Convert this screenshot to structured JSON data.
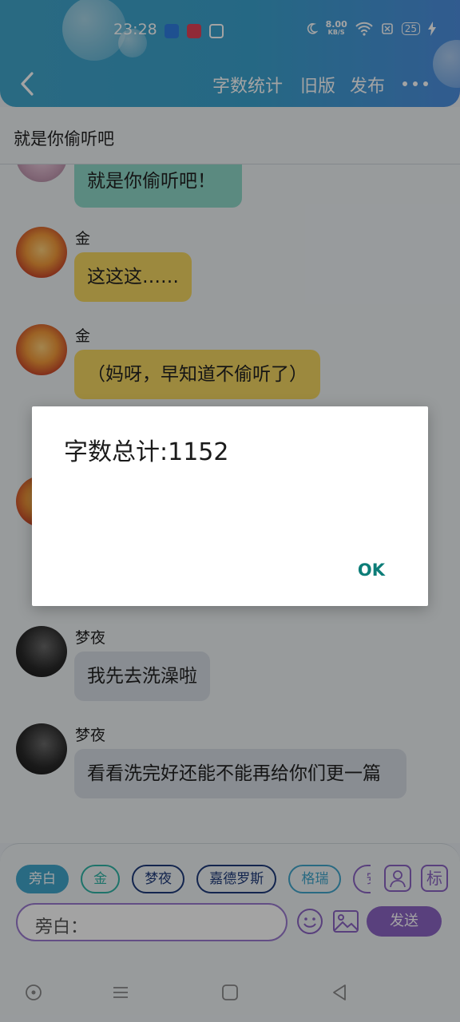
{
  "status_bar": {
    "time": "23:28",
    "net_speed_value": "8.00",
    "net_speed_unit": "KB/S",
    "battery": "25"
  },
  "nav": {
    "actions": [
      "字数统计",
      "旧版",
      "发布"
    ]
  },
  "subtitle": "就是你偷听吧",
  "messages": [
    {
      "sender": "",
      "text": "就是你偷听吧！",
      "bubble": "teal"
    },
    {
      "sender": "金",
      "text": "这这这……",
      "bubble": "yellow"
    },
    {
      "sender": "金",
      "text": "（妈呀，早知道不偷听了）",
      "bubble": "yellow"
    },
    {
      "sender": "梦夜",
      "text": "我先去洗澡啦",
      "bubble": "gray"
    },
    {
      "sender": "梦夜",
      "text": "看看洗完好还能不能再给你们更一篇",
      "bubble": "gray"
    }
  ],
  "dialog": {
    "message": "字数总计:1152",
    "ok_label": "OK"
  },
  "input_bar": {
    "roles": [
      "旁白",
      "金",
      "梦夜",
      "嘉德罗斯",
      "格瑞",
      "安"
    ],
    "selected_role": "旁白",
    "placeholder": "旁白：",
    "role_icon_label": "标",
    "send_label": "发送"
  },
  "colors": {
    "header": "#41a6cc",
    "accent_purple": "#8b64c4",
    "ok_teal": "#0c7d78",
    "bubble_teal": "#8fd8c8",
    "bubble_yellow": "#f5d662",
    "bubble_gray": "#d7dde4"
  }
}
